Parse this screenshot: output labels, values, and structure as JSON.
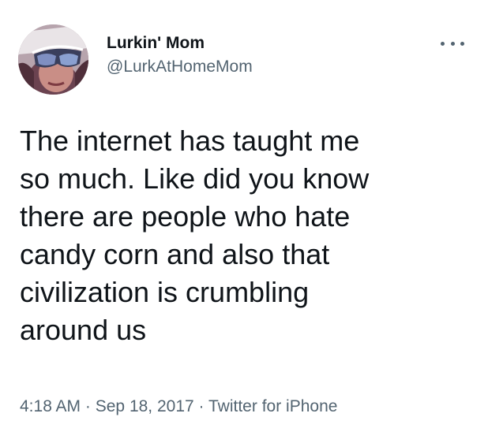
{
  "tweet": {
    "author": {
      "display_name": "Lurkin' Mom",
      "handle": "@LurkAtHomeMom"
    },
    "more_icon": "more-horizontal-icon",
    "text": "The internet has taught me\nso much. Like did you know\nthere are people who hate\ncandy corn and also that\ncivilization is crumbling\naround us",
    "meta": {
      "time": "4:18 AM",
      "separator": "·",
      "date": "Sep 18, 2017",
      "source": "Twitter for iPhone"
    }
  },
  "colors": {
    "text_primary": "#0f1419",
    "text_secondary": "#536471",
    "background": "#ffffff"
  }
}
